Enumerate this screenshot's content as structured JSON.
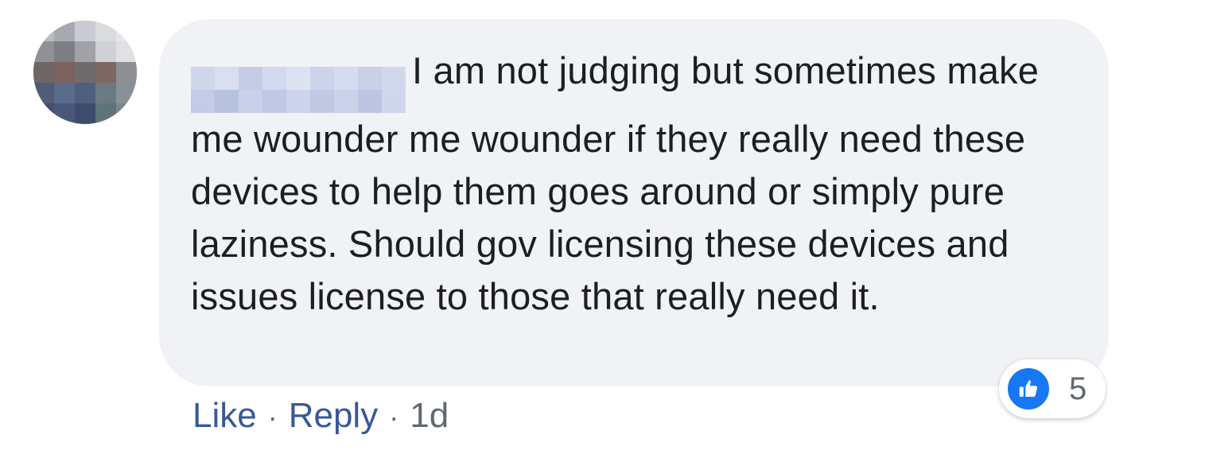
{
  "comment": {
    "text": "I am not judging but sometimes make me wounder me wounder if they really need these devices to help them goes around or simply pure laziness. Should gov licensing these devices and issues license to those that really need it."
  },
  "reactions": {
    "icon": "thumbs-up-icon",
    "count": "5",
    "color": "#1877f2"
  },
  "actions": {
    "like_label": "Like",
    "separator": "·",
    "reply_label": "Reply",
    "time": "1d"
  },
  "colors": {
    "bubble": "#f0f2f5",
    "link": "#385898",
    "meta": "#606770"
  }
}
